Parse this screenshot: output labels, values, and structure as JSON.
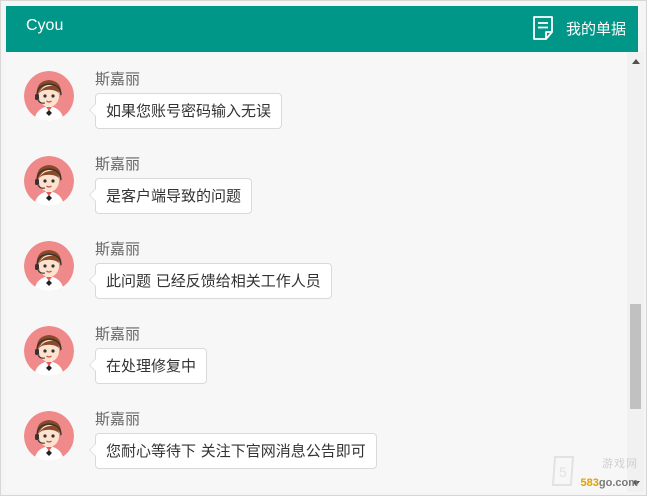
{
  "header": {
    "title": "Cyou",
    "orders_label": "我的单据",
    "background": "#009688"
  },
  "messages": [
    {
      "sender": "斯嘉丽",
      "text": "如果您账号密码输入无误"
    },
    {
      "sender": "斯嘉丽",
      "text": "是客户端导致的问题"
    },
    {
      "sender": "斯嘉丽",
      "text": "此问题 已经反馈给相关工作人员"
    },
    {
      "sender": "斯嘉丽",
      "text": "在处理修复中"
    },
    {
      "sender": "斯嘉丽",
      "text": "您耐心等待下  关注下官网消息公告即可"
    }
  ],
  "watermark": {
    "name": "游戏网",
    "site_prefix": "583",
    "site_suffix": "go.com"
  }
}
